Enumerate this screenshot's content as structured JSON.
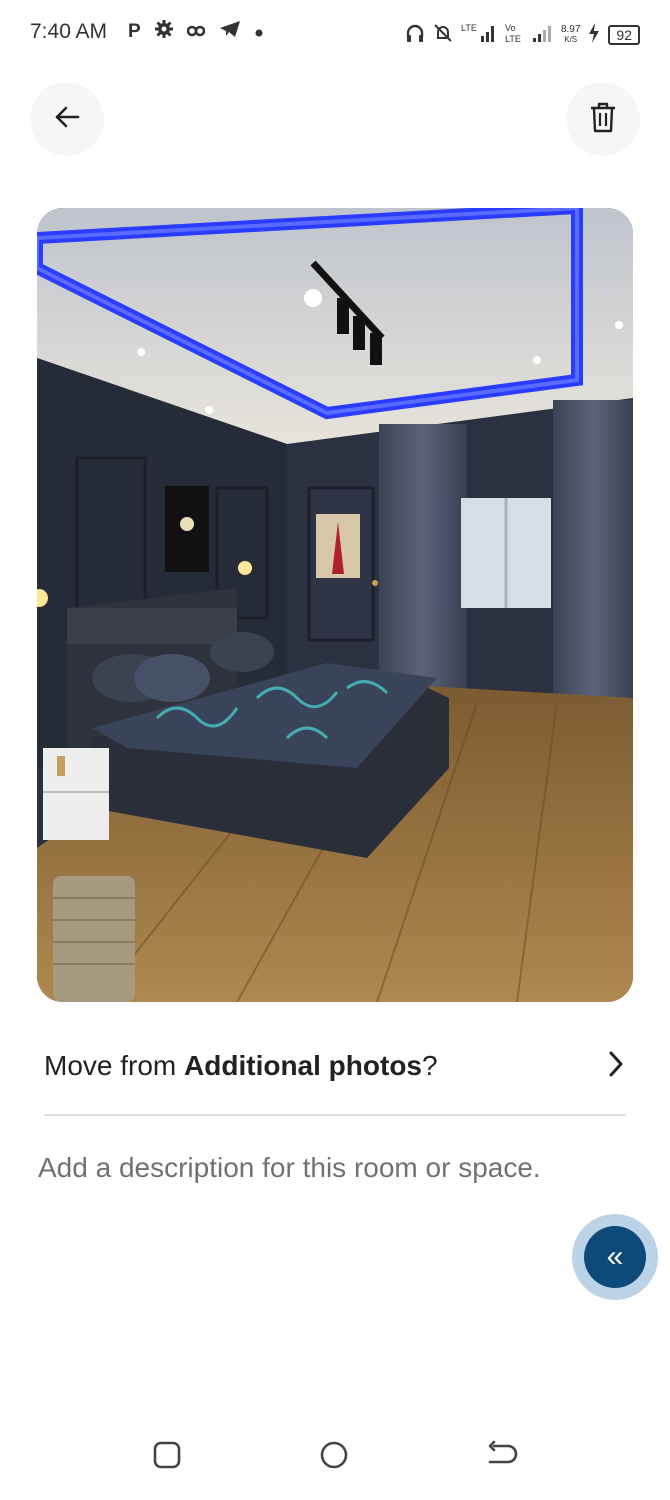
{
  "status_bar": {
    "time": "7:40 AM",
    "left_icons": [
      "P",
      "gear-icon",
      "link-icon",
      "telegram-icon",
      "dot-icon"
    ],
    "network_speed": "8.97",
    "speed_unit": "K/S",
    "battery": "92"
  },
  "header": {
    "back_icon": "arrow-left-icon",
    "delete_icon": "trash-icon"
  },
  "photo": {
    "description": "bedroom"
  },
  "move_row": {
    "prefix": "Move from ",
    "bold": "Additional photos",
    "suffix": "?"
  },
  "description_placeholder": "Add a description for this room or space.",
  "fab": {
    "icon": "double-chevron-left-icon",
    "glyph": "«"
  },
  "nav": {
    "icons": [
      "recent-apps-icon",
      "home-icon",
      "back-icon"
    ]
  },
  "colors": {
    "accent": "#0e4a79",
    "accent_ring": "#bcd2e6",
    "muted_text": "#717171"
  }
}
